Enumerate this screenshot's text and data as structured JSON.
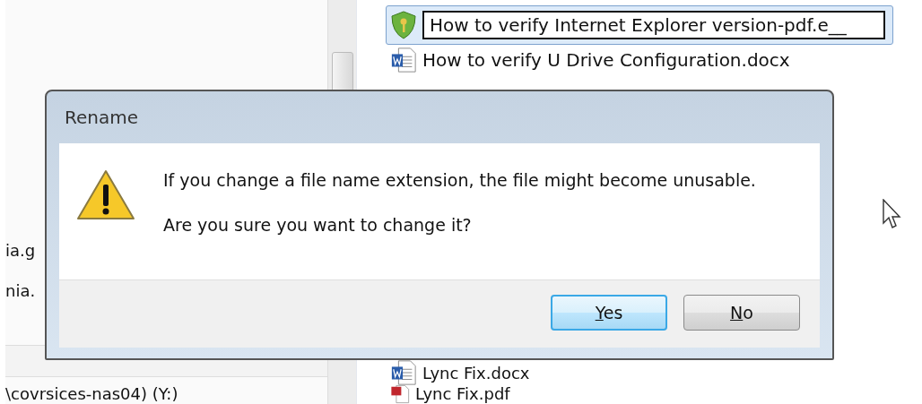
{
  "left_pane": {
    "items": [
      "ia.g",
      "nia."
    ],
    "drive_label": "\\covrsices-nas04) (Y:)"
  },
  "file_list": {
    "items": [
      {
        "kind": "shield",
        "name": "How to verify Internet Explorer version-pdf.e__",
        "selected": true,
        "renaming": true
      },
      {
        "kind": "word",
        "name": "How to verify U Drive Configuration.docx",
        "selected": false,
        "renaming": false
      },
      {
        "kind": "word",
        "name": "Lync Fix.docx",
        "selected": false,
        "renaming": false
      },
      {
        "kind": "pdf",
        "name": "Lync Fix.pdf",
        "selected": false,
        "renaming": false
      }
    ]
  },
  "dialog": {
    "title": "Rename",
    "message": "If you change a file name extension, the file might become unusable.",
    "question": "Are you sure you want to change it?",
    "buttons": [
      {
        "label": "Yes",
        "selected": true
      },
      {
        "label": "No",
        "selected": false
      }
    ]
  }
}
